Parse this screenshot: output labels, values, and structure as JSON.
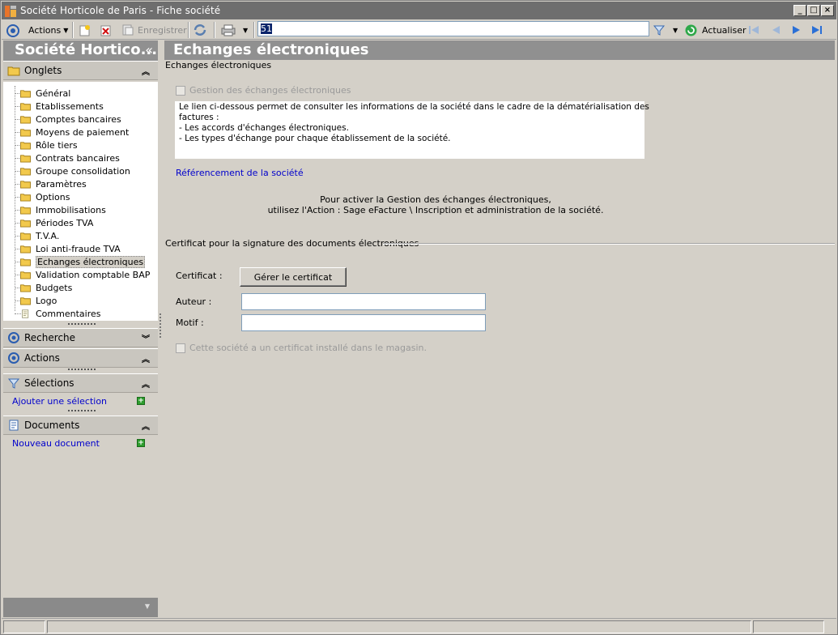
{
  "window": {
    "title": "Société Horticole de Paris - Fiche société"
  },
  "toolbar": {
    "actions_label": "Actions",
    "save_label": "Enregistrer",
    "search_value": "51",
    "refresh_label": "Actualiser"
  },
  "left": {
    "header": "Société Hortico...",
    "collapse_glyph": "«",
    "onglets_label": "Onglets",
    "tree_items": [
      "Général",
      "Etablissements",
      "Comptes bancaires",
      "Moyens de paiement",
      "Rôle tiers",
      "Contrats bancaires",
      "Groupe consolidation",
      "Paramètres",
      "Options",
      "Immobilisations",
      "Périodes TVA",
      "T.V.A.",
      "Loi anti-fraude TVA",
      "Echanges électroniques",
      "Validation comptable BAP",
      "Budgets",
      "Logo",
      "Commentaires"
    ],
    "selected_item": "Echanges électroniques",
    "recherche_label": "Recherche",
    "actions_label": "Actions",
    "selections_label": "Sélections",
    "add_selection_label": "Ajouter une sélection",
    "documents_label": "Documents",
    "new_document_label": "Nouveau document"
  },
  "main": {
    "header": "Echanges électroniques",
    "group1_title": "Echanges électroniques",
    "gestion_checkbox_label": "Gestion des échanges électroniques",
    "gestion_checked": false,
    "info_lines": [
      "Le lien ci-dessous permet de consulter les informations de la société dans le cadre de la dématérialisation des",
      "factures :",
      "- Les accords d'échanges électroniques.",
      "- Les types d'échange pour chaque établissement de la société."
    ],
    "referencing_link": "Référencement de la société",
    "activation_line1": "Pour activer la Gestion des échanges électroniques,",
    "activation_line2": "utilisez l'Action : Sage eFacture \\ Inscription et administration de la société.",
    "group2_title": "Certificat pour la signature des documents électroniques",
    "certificat_label": "Certificat :",
    "manage_certificate_button": "Gérer le certificat",
    "auteur_label": "Auteur  :",
    "auteur_value": "",
    "motif_label": "Motif :",
    "motif_value": "",
    "installed_checkbox_label": "Cette société a un certificat installé dans le magasin.",
    "installed_checked": false
  }
}
